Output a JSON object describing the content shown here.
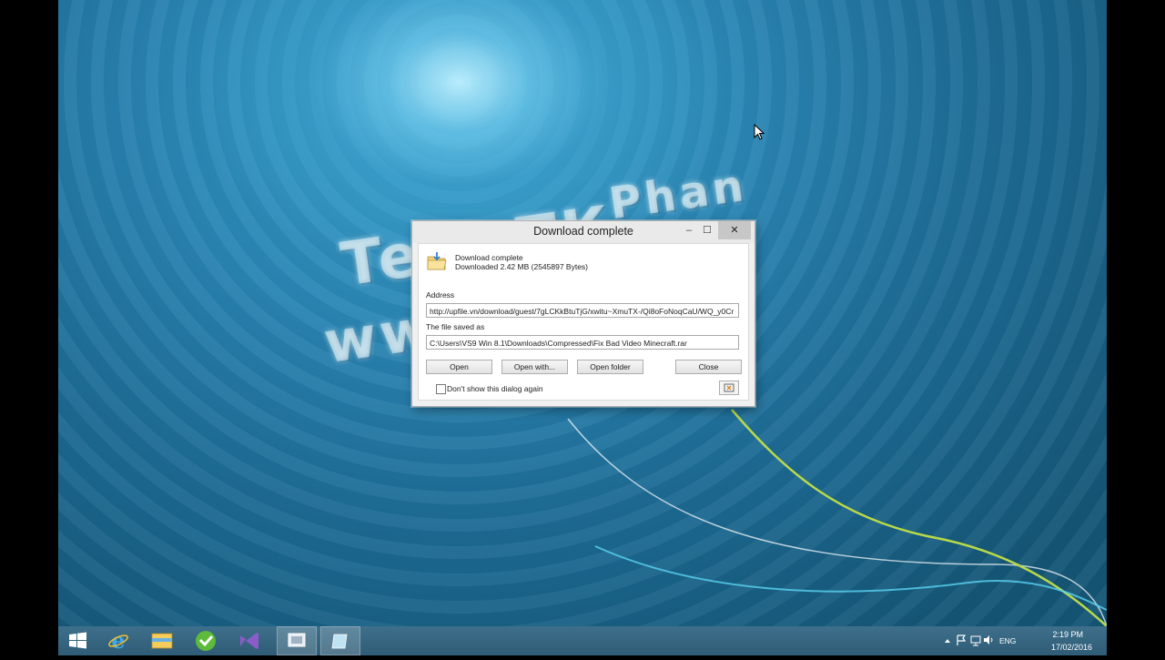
{
  "watermark": {
    "line1": "Phan",
    "line2": "Te                 2.TK",
    "line3": "ww"
  },
  "dialog": {
    "title": "Download complete",
    "titlebar_buttons": {
      "minimize": "–",
      "maximize": "☐",
      "close": "✕"
    },
    "status_line1": "Download complete",
    "status_line2": "Downloaded  2.42  MB  (2545897 Bytes)",
    "address_label": "Address",
    "address_value": "http://upfile.vn/download/guest/7gLCKkBtuTjG/xwitu~XmuTX-/Qi8oFoNoqCaU/WQ_y0Cr",
    "saved_label": "The file saved as",
    "saved_value": "C:\\Users\\VS9 Win 8.1\\Downloads\\Compressed\\Fix Bad Video Minecraft.rar",
    "buttons": {
      "open": "Open",
      "open_with": "Open with...",
      "open_folder": "Open folder",
      "close": "Close"
    },
    "checkbox_label": "Don't show this dialog again",
    "checkbox_checked": false
  },
  "taskbar": {
    "items": [
      "start-icon",
      "internet-explorer-icon",
      "file-explorer-icon",
      "download-manager-icon",
      "visual-studio-icon",
      "video-app-icon",
      "notepad-icon"
    ],
    "tray": {
      "language": "ENG",
      "time": "2:19 PM",
      "date": "17/02/2016"
    }
  },
  "colors": {
    "accent": "#2f5c76",
    "desktop": "#2a86b4"
  }
}
